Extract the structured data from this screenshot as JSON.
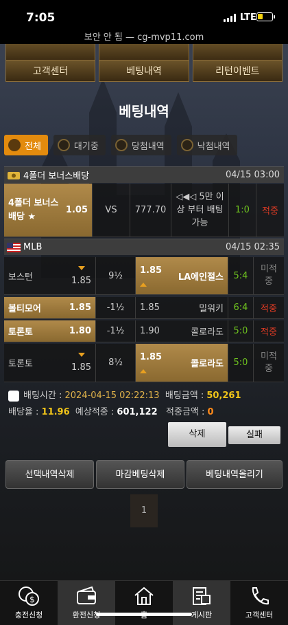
{
  "status_bar": {
    "time": "7:05",
    "network": "LTE"
  },
  "browser": {
    "url": "보안 안 됨 — cg-mvp11.com"
  },
  "top_menu": [
    "고객센터",
    "베팅내역",
    "리턴이벤트"
  ],
  "page_title": "베팅내역",
  "filter_tabs": [
    "전체",
    "대기중",
    "당첨내역",
    "낙첨내역"
  ],
  "bet1": {
    "league": "4폴더 보너스배당",
    "datetime": "04/15 03:00",
    "home": "4폴더 보너스배당 ★",
    "home_odds": "1.05",
    "vs": "VS",
    "draw": "777.70",
    "away": "◁◀◁ 5만 이상 부터 배팅 가능",
    "score": "1:0",
    "result": "적중"
  },
  "bet2": {
    "league": "MLB",
    "datetime": "04/15 02:35",
    "rows": [
      {
        "home": "보스턴",
        "home_odds": "1.85",
        "handicap": "9½",
        "away_odds": "1.85",
        "away": "LA에인절스",
        "score": "5:4",
        "result": "미적중"
      },
      {
        "home": "볼티모어",
        "home_odds": "1.85",
        "handicap": "-1½",
        "away_odds": "1.85",
        "away": "밀워키",
        "score": "6:4",
        "result": "적중"
      },
      {
        "home": "토론토",
        "home_odds": "1.80",
        "handicap": "-1½",
        "away_odds": "1.90",
        "away": "콜로라도",
        "score": "5:0",
        "result": "적중"
      },
      {
        "home": "토론토",
        "home_odds": "1.85",
        "handicap": "8½",
        "away_odds": "1.85",
        "away": "콜로라도",
        "score": "5:0",
        "result": "미적중"
      }
    ]
  },
  "summary": {
    "bet_time_label": "배팅시간 : ",
    "bet_time": "2024-04-15 02:22:13",
    "bet_amount_label": "배팅금액 : ",
    "bet_amount": "50,261",
    "odds_label": "배당율 : ",
    "odds": "11.96",
    "expected_label": "예상적중 : ",
    "expected": "601,122",
    "win_label": "적중금액 : ",
    "win": "0"
  },
  "actions": {
    "delete": "삭제",
    "fail": "실패",
    "delete_selected": "선택내역삭제",
    "delete_closed": "마감베팅삭제",
    "upload": "베팅내역올리기"
  },
  "pagination": {
    "current": "1"
  },
  "bottom_nav": [
    "충전신청",
    "환전신청",
    "홈",
    "게시판",
    "고객센터"
  ],
  "colors": {
    "accent": "#e38b0e",
    "win": "#e03b24",
    "score": "#6fc31f",
    "highlight": "#f0c419"
  }
}
